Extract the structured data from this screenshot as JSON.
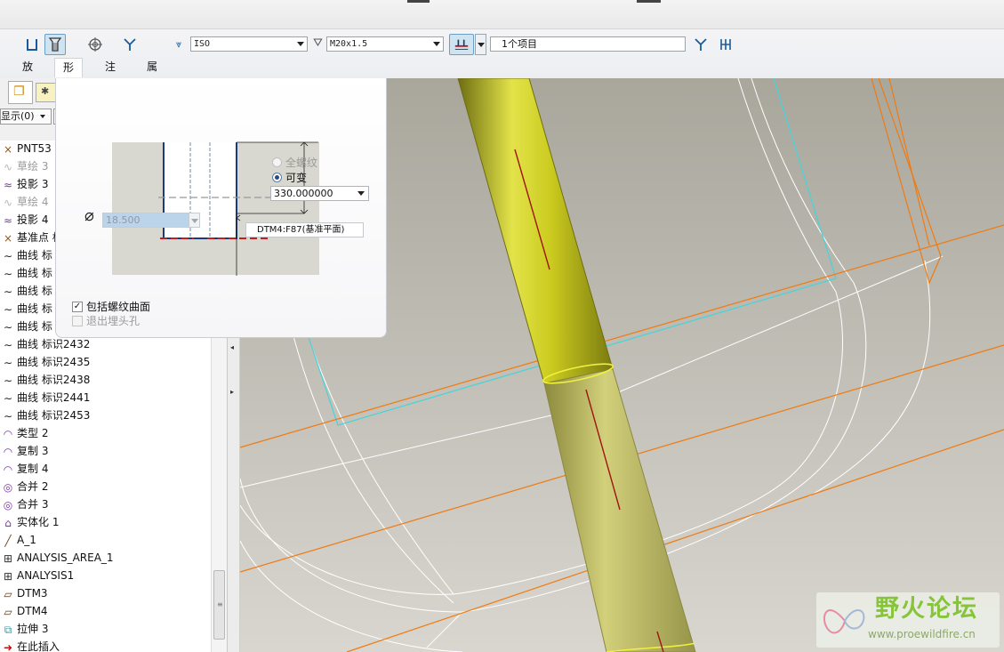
{
  "toolbar": {
    "buttons": [
      {
        "name": "hole-type-straight",
        "icon": "straight-hole-icon",
        "pressed": false
      },
      {
        "name": "hole-type-standard",
        "icon": "standard-hole-icon",
        "pressed": true
      },
      {
        "name": "sketch-placement",
        "icon": "target-icon",
        "pressed": false
      },
      {
        "name": "add-tapping",
        "icon": "tap-icon",
        "pressed": false
      }
    ],
    "standard_value": "ISO",
    "screw_size_value": "M20x1.5",
    "reference_value": "1个项目",
    "tabs": [
      "放置",
      "形状",
      "注释",
      "属性"
    ],
    "active_tab": "形状"
  },
  "shape_panel": {
    "radio_full_thread": "全螺纹",
    "radio_variable": "可变",
    "depth_value": "330.000000",
    "diameter_value": "18.500",
    "reference_label": "DTM4:F87(基准平面)",
    "include_thread_surface": "包括螺纹曲面",
    "exit_countersink": "退出埋头孔"
  },
  "tree": {
    "show_button": "显示",
    "show_count": "(0)",
    "items": [
      {
        "label": "PNT53",
        "icon": "datum-point-icon",
        "grey": false
      },
      {
        "label": "草绘 3",
        "icon": "sketch-icon",
        "grey": true
      },
      {
        "label": "投影 3",
        "icon": "projection-icon",
        "grey": false
      },
      {
        "label": "草绘 4",
        "icon": "sketch-icon",
        "grey": true
      },
      {
        "label": "投影 4",
        "icon": "projection-icon",
        "grey": false
      },
      {
        "label": "基准点 标",
        "icon": "datum-point-icon",
        "grey": false
      },
      {
        "label": "曲线 标",
        "icon": "curve-icon",
        "grey": false
      },
      {
        "label": "曲线 标",
        "icon": "curve-icon",
        "grey": false
      },
      {
        "label": "曲线 标",
        "icon": "curve-icon",
        "grey": false
      },
      {
        "label": "曲线 标",
        "icon": "curve-icon",
        "grey": false
      },
      {
        "label": "曲线 标",
        "icon": "curve-icon",
        "grey": false
      },
      {
        "label": "曲线 标识2432",
        "icon": "curve-icon",
        "grey": false
      },
      {
        "label": "曲线 标识2435",
        "icon": "curve-icon",
        "grey": false
      },
      {
        "label": "曲线 标识2438",
        "icon": "curve-icon",
        "grey": false
      },
      {
        "label": "曲线 标识2441",
        "icon": "curve-icon",
        "grey": false
      },
      {
        "label": "曲线 标识2453",
        "icon": "curve-icon",
        "grey": false
      },
      {
        "label": "类型 2",
        "icon": "surface-icon",
        "grey": false
      },
      {
        "label": "复制 3",
        "icon": "surface-icon",
        "grey": false
      },
      {
        "label": "复制 4",
        "icon": "surface-icon",
        "grey": false
      },
      {
        "label": "合并 2",
        "icon": "merge-icon",
        "grey": false
      },
      {
        "label": "合并 3",
        "icon": "merge-icon",
        "grey": false
      },
      {
        "label": "实体化 1",
        "icon": "solidify-icon",
        "grey": false
      },
      {
        "label": "A_1",
        "icon": "axis-icon",
        "grey": false
      },
      {
        "label": "ANALYSIS_AREA_1",
        "icon": "analysis-icon",
        "grey": false
      },
      {
        "label": "ANALYSIS1",
        "icon": "analysis-icon",
        "grey": false
      },
      {
        "label": "DTM3",
        "icon": "datum-plane-icon",
        "grey": false
      },
      {
        "label": "DTM4",
        "icon": "datum-plane-icon",
        "grey": false
      },
      {
        "label": "拉伸 3",
        "icon": "extrude-icon",
        "grey": false
      },
      {
        "label": "在此插入",
        "icon": "insert-here-icon",
        "grey": false
      }
    ]
  },
  "watermark": {
    "title": "野火论坛",
    "url": "www.proewildfire.cn"
  },
  "colors": {
    "viewport_bg_top": "#a9a79c",
    "viewport_bg_bottom": "#d8d6cf",
    "cylinder": "#cbcb1f",
    "datum_orange": "#f07a10",
    "datum_cyan": "#44d4dc",
    "wire": "#ffffff",
    "axis_red": "#a01414"
  }
}
